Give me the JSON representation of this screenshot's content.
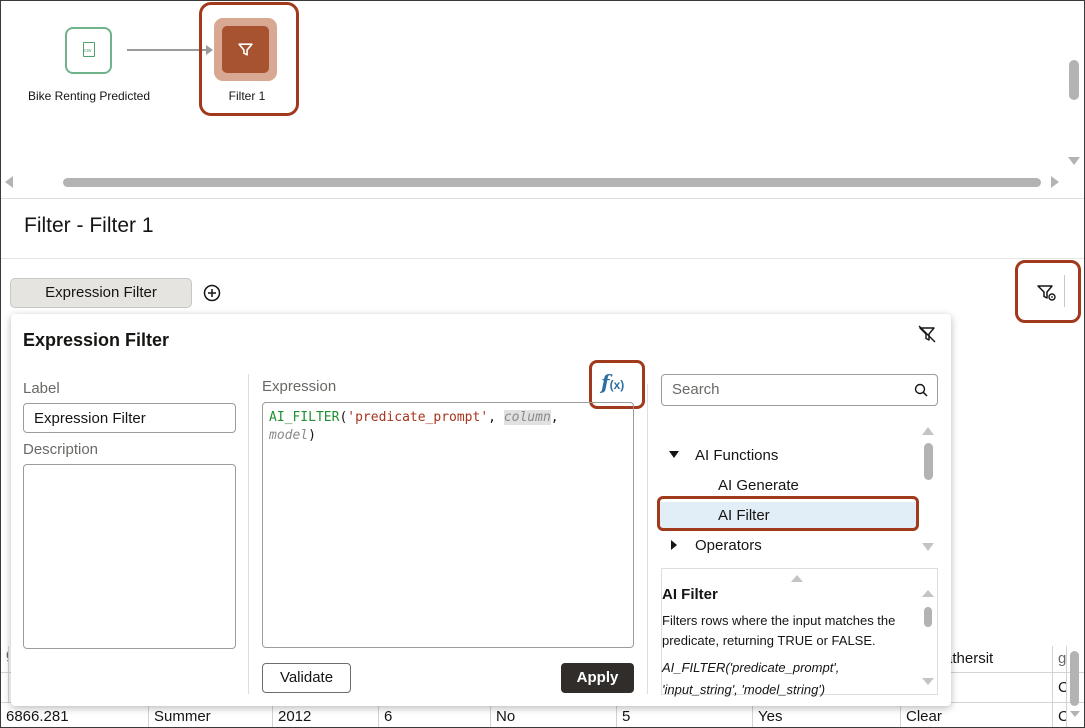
{
  "canvas": {
    "source_node": {
      "label": "Bike Renting Predicted",
      "icon": "csv-file-icon"
    },
    "filter_node": {
      "label": "Filter 1",
      "icon": "filter-icon"
    }
  },
  "step": {
    "title": "Filter - Filter 1",
    "tab_label": "Expression Filter",
    "add_icon": "plus-circle-icon",
    "settings_icon": "filter-settings-icon"
  },
  "popup": {
    "title": "Expression Filter",
    "close_icon": "clear-filter-icon",
    "label_caption": "Label",
    "label_value": "Expression Filter",
    "description_caption": "Description",
    "description_value": "",
    "expression_caption": "Expression",
    "fx_label": "f",
    "fx_sub": "(x)",
    "expression": {
      "fn": "AI_FILTER",
      "open": "(",
      "arg1": "'predicate_prompt'",
      "sep1": ", ",
      "arg2": "column",
      "sep2": ",",
      "arg3": "model",
      "close": ")"
    },
    "validate_label": "Validate",
    "apply_label": "Apply",
    "search_placeholder": "Search",
    "tree": {
      "group1": "AI Functions",
      "items": [
        "AI Generate",
        "AI Filter"
      ],
      "group2": "Operators"
    },
    "help": {
      "title": "AI Filter",
      "description": "Filters rows where the input matches the predicate, returning TRUE or FALSE.",
      "signature_line1": "AI_FILTER('predicate_prompt',",
      "signature_line2": "'input_string', 'model_string')"
    }
  },
  "table": {
    "header_partial": [
      "g",
      "athersit",
      "g"
    ],
    "row1": [
      "",
      "",
      "",
      "",
      "",
      "",
      "",
      "",
      "C"
    ],
    "row2": [
      "6866.281",
      "Summer",
      "2012",
      "6",
      "No",
      "5",
      "Yes",
      "Clear",
      "C"
    ]
  },
  "colors": {
    "highlight": "#a1391c",
    "filter_node": "#a8532f",
    "source_node_border": "#6fb38a",
    "apply_bg": "#312d2a",
    "selected_row": "#e2eef7"
  }
}
